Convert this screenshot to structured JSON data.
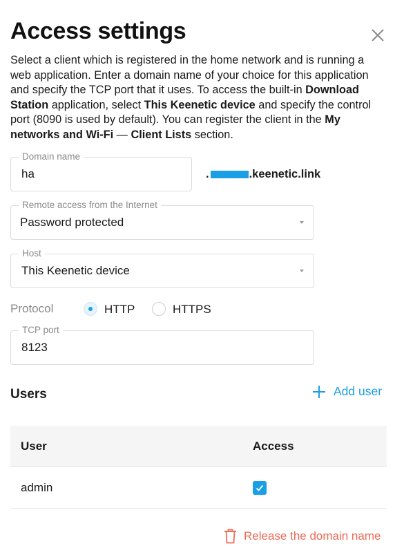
{
  "dialog": {
    "title": "Access settings",
    "close_icon": "close-icon"
  },
  "description": {
    "p1": "Select a client which is registered in the home network and is running a web application. Enter a domain name of your choice for this application and specify the TCP port that it uses. To access the built-in ",
    "b1": "Download Station",
    "p2": " application, select ",
    "b2": "This Keenetic device",
    "p3": " and specify the control port (8090 is used by default). You can register the client in the ",
    "b3": "My networks and Wi-Fi",
    "p4": " — ",
    "b4": "Client Lists",
    "p5": " section."
  },
  "domain": {
    "label": "Domain name",
    "value": "ha",
    "suffix_prefix": ".",
    "suffix": ".keenetic.link"
  },
  "remote_access": {
    "label": "Remote access from the Internet",
    "value": "Password protected"
  },
  "host": {
    "label": "Host",
    "value": "This Keenetic device"
  },
  "protocol": {
    "label": "Protocol",
    "options": [
      "HTTP",
      "HTTPS"
    ],
    "selected": "HTTP"
  },
  "tcp_port": {
    "label": "TCP port",
    "value": "8123"
  },
  "users": {
    "title": "Users",
    "add_label": "Add user",
    "columns": [
      "User",
      "Access"
    ],
    "rows": [
      {
        "user": "admin",
        "access": true
      }
    ]
  },
  "release_label": "Release the domain name",
  "colors": {
    "accent": "#1a9fe6",
    "danger": "#f06b56",
    "muted": "#8a8a8a"
  }
}
